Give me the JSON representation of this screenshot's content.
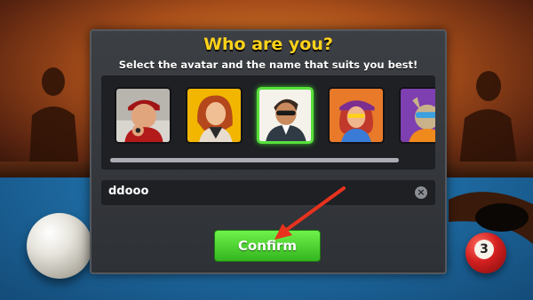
{
  "dialog": {
    "title": "Who are you?",
    "subtitle": "Select the avatar and the name that suits you best!"
  },
  "avatars": [
    {
      "icon": "avatar-cap-man-icon",
      "selected": false
    },
    {
      "icon": "avatar-redhead-woman-icon",
      "selected": false
    },
    {
      "icon": "avatar-sunglasses-man-icon",
      "selected": true
    },
    {
      "icon": "avatar-purple-hat-woman-icon",
      "selected": false
    },
    {
      "icon": "avatar-dog-sunglasses-icon",
      "selected": false
    }
  ],
  "name_field": {
    "value": "ddooo",
    "clear_icon": "×"
  },
  "confirm_label": "Confirm",
  "balls": {
    "three": "3"
  },
  "colors": {
    "title": "#ffd21a",
    "confirm": "#3cc02a",
    "selected_border": "#58e03c",
    "arrow": "#e8321e"
  }
}
